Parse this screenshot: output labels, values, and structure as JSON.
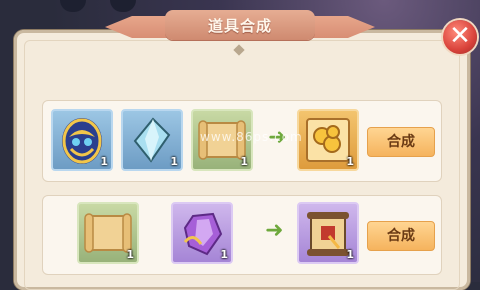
{
  "window": {
    "title": "道具合成"
  },
  "watermark": "www.86ps.com",
  "rows": [
    {
      "inputs": [
        {
          "name": "golden-orb",
          "count": "1"
        },
        {
          "name": "crystal-shard",
          "count": "1"
        },
        {
          "name": "scroll",
          "count": "1"
        }
      ],
      "output": {
        "name": "gold-coins-scroll",
        "count": "1"
      },
      "button": "合成"
    },
    {
      "inputs": [
        {
          "name": "scroll",
          "count": "1"
        },
        {
          "name": "purple-crystal",
          "count": "1"
        }
      ],
      "output": {
        "name": "sealed-scroll",
        "count": "1"
      },
      "button": "合成"
    }
  ]
}
